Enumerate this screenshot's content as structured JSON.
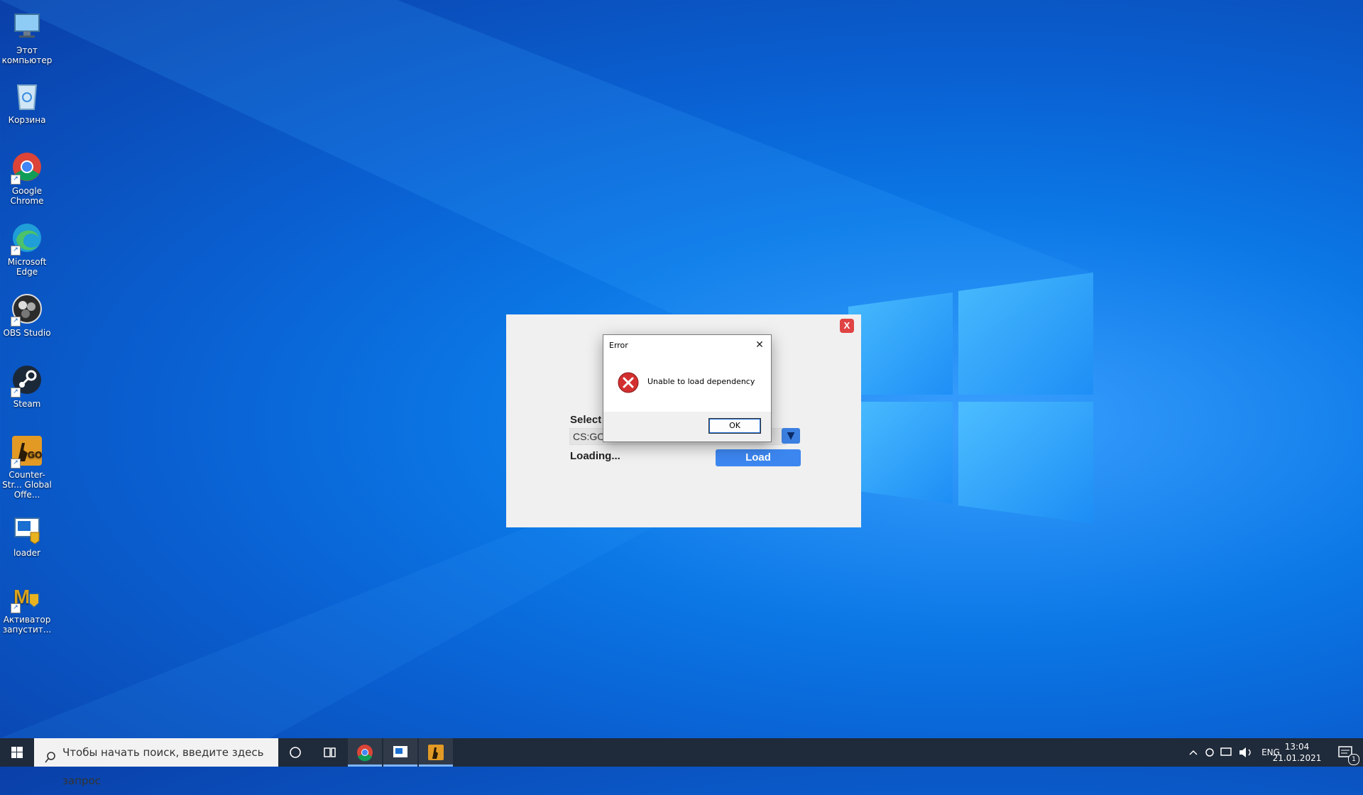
{
  "desktop": {
    "icons": [
      {
        "label": "Этот компьютер",
        "icon": "this-pc-icon"
      },
      {
        "label": "Корзина",
        "icon": "recycle-bin-icon"
      },
      {
        "label": "Google Chrome",
        "icon": "chrome-icon"
      },
      {
        "label": "Microsoft Edge",
        "icon": "edge-icon"
      },
      {
        "label": "OBS Studio",
        "icon": "obs-icon"
      },
      {
        "label": "Steam",
        "icon": "steam-icon"
      },
      {
        "label": "Counter-Str... Global Offe...",
        "icon": "csgo-icon"
      },
      {
        "label": "loader",
        "icon": "loader-icon"
      },
      {
        "label": "Активатор запустит...",
        "icon": "activator-icon"
      }
    ]
  },
  "app": {
    "close_label": "X",
    "select_label": "Select",
    "select_value": "CS:GO",
    "loading_text": "Loading...",
    "load_button": "Load"
  },
  "dialog": {
    "title": "Error",
    "message": "Unable to load dependency",
    "ok_button": "OK"
  },
  "taskbar": {
    "search_placeholder": "Чтобы начать поиск, введите здесь запрос",
    "language": "ENG",
    "time": "13:04",
    "date": "21.01.2021",
    "notification_count": "1"
  },
  "colors": {
    "accent": "#3c86f0",
    "close_red": "#e04343",
    "taskbar": "#1f2a3a"
  }
}
